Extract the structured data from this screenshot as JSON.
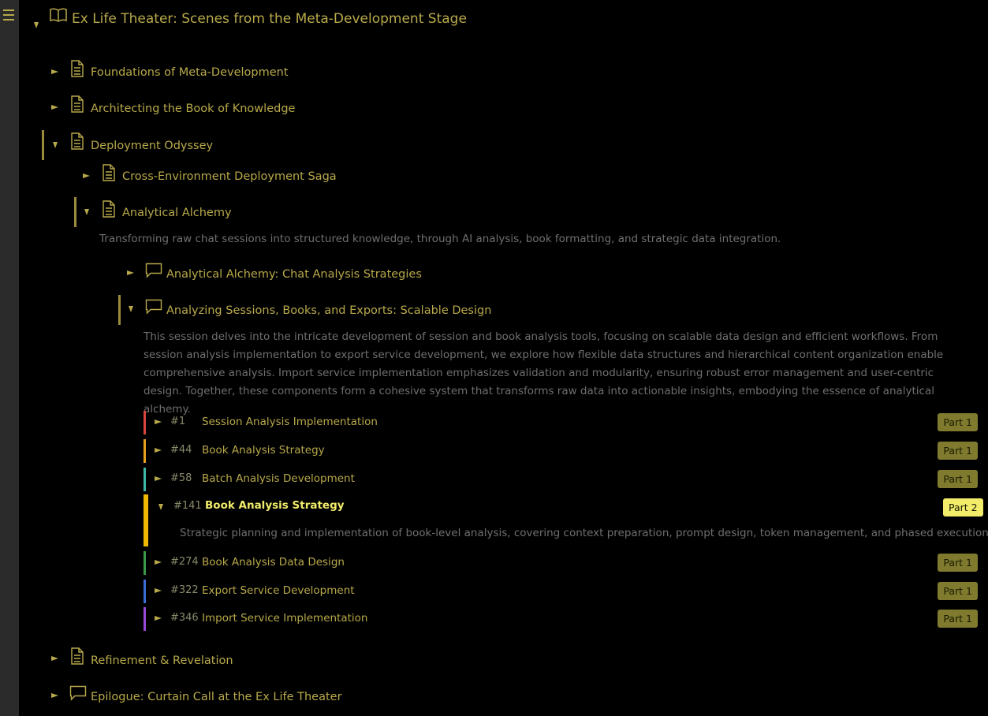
{
  "menu": {
    "icon": "hamburger-menu-icon"
  },
  "book": {
    "title": "Ex Life Theater: Scenes from the Meta-Development Stage",
    "icon": "book-open-icon"
  },
  "sections": {
    "s1": {
      "label": "Foundations of Meta-Development",
      "icon": "document-icon"
    },
    "s2": {
      "label": "Architecting the Book of Knowledge",
      "icon": "document-icon"
    },
    "s3": {
      "label": "Deployment Odyssey",
      "icon": "document-icon"
    },
    "s3a": {
      "label": "Cross-Environment Deployment Saga",
      "icon": "document-icon"
    },
    "s3b": {
      "label": "Analytical Alchemy",
      "icon": "document-icon",
      "description": "Transforming raw chat sessions into structured knowledge, through AI analysis, book formatting, and strategic data integration."
    },
    "sess1": {
      "label": "Analytical Alchemy: Chat Analysis Strategies",
      "icon": "chat-bubble-icon"
    },
    "sess2": {
      "label": "Analyzing Sessions, Books, and Exports: Scalable Design",
      "icon": "chat-bubble-icon",
      "description": "This session delves into the intricate development of session and book analysis tools, focusing on scalable data design and efficient workflows. From session analysis implementation to export service development, we explore how flexible data structures and hierarchical content organization enable comprehensive analysis. Import service implementation emphasizes validation and modularity, ensuring robust error management and user-centric design. Together, these components form a cohesive system that transforms raw data into actionable insights, embodying the essence of analytical alchemy."
    },
    "s4": {
      "label": "Refinement & Revelation",
      "icon": "document-icon"
    },
    "s5": {
      "label": "Epilogue: Curtain Call at the Ex Life Theater",
      "icon": "chat-bubble-icon"
    }
  },
  "chats": [
    {
      "num": "#1",
      "title": "Session Analysis Implementation",
      "badge": "Part 1",
      "color": "#d9453a"
    },
    {
      "num": "#44",
      "title": "Book Analysis Strategy",
      "badge": "Part 1",
      "color": "#e8a020"
    },
    {
      "num": "#58",
      "title": "Batch Analysis Development",
      "badge": "Part 1",
      "color": "#3fb8a8"
    },
    {
      "num": "#141",
      "title": "Book Analysis Strategy",
      "badge": "Part 2",
      "color": "#f0b800",
      "description": "Strategic planning and implementation of book-level analysis, covering context preparation, prompt design, token management, and phased execution."
    },
    {
      "num": "#274",
      "title": "Book Analysis Data Design",
      "badge": "Part 1",
      "color": "#3a9a4a"
    },
    {
      "num": "#322",
      "title": "Export Service Development",
      "badge": "Part 1",
      "color": "#3a6fd9"
    },
    {
      "num": "#346",
      "title": "Import Service Implementation",
      "badge": "Part 1",
      "color": "#9a4ad9"
    }
  ],
  "colors": {
    "accent": "#b8a94a",
    "background": "#000000",
    "rail": "#2b2b2b",
    "badge": "#7f7a2e",
    "badge_active": "#f2ec6a"
  }
}
